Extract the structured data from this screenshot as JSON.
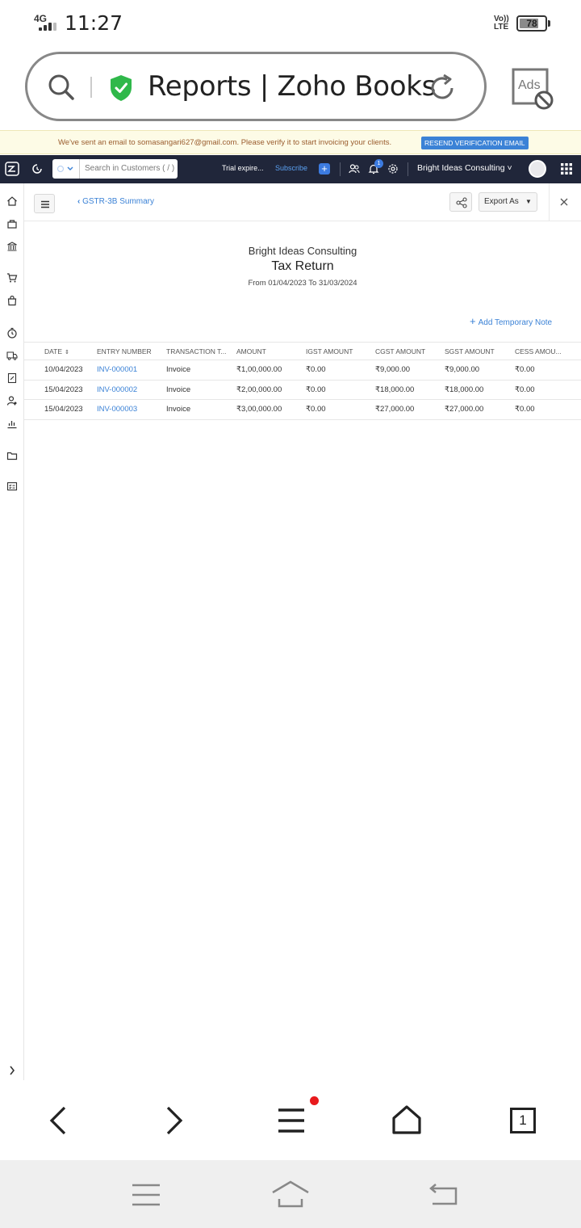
{
  "status_bar": {
    "network": "4G",
    "time": "11:27",
    "volte": "Vo)) LTE",
    "battery_percent": 78,
    "battery_label": "78"
  },
  "browser": {
    "page_title": "Reports | Zoho Books",
    "ads_label": "Ads",
    "tab_count": "1",
    "menu_has_notification": true
  },
  "banner": {
    "message": "We've sent an email to somasangari627@gmail.com. Please verify it to start invoicing your clients.",
    "resend_label": "RESEND VERIFICATION EMAIL"
  },
  "app_header": {
    "search_placeholder": "Search in Customers ( / )",
    "trial_text": "Trial expire...",
    "subscribe_label": "Subscribe",
    "notification_count": "1",
    "org_name": "Bright Ideas Consulting"
  },
  "subheader": {
    "back_label": "GSTR-3B Summary",
    "export_label": "Export As"
  },
  "report": {
    "org": "Bright Ideas Consulting",
    "title": "Tax Return",
    "period": "From 01/04/2023 To 31/03/2024",
    "add_note_label": "Add Temporary Note"
  },
  "table": {
    "columns": [
      "DATE",
      "ENTRY NUMBER",
      "TRANSACTION T...",
      "AMOUNT",
      "IGST AMOUNT",
      "CGST AMOUNT",
      "SGST AMOUNT",
      "CESS AMOU..."
    ],
    "rows": [
      {
        "date": "10/04/2023",
        "entry": "INV-000001",
        "type": "Invoice",
        "amount": "₹1,00,000.00",
        "igst": "₹0.00",
        "cgst": "₹9,000.00",
        "sgst": "₹9,000.00",
        "cess": "₹0.00"
      },
      {
        "date": "15/04/2023",
        "entry": "INV-000002",
        "type": "Invoice",
        "amount": "₹2,00,000.00",
        "igst": "₹0.00",
        "cgst": "₹18,000.00",
        "sgst": "₹18,000.00",
        "cess": "₹0.00"
      },
      {
        "date": "15/04/2023",
        "entry": "INV-000003",
        "type": "Invoice",
        "amount": "₹3,00,000.00",
        "igst": "₹0.00",
        "cgst": "₹27,000.00",
        "sgst": "₹27,000.00",
        "cess": "₹0.00"
      }
    ]
  },
  "colors": {
    "header_bg": "#20263a",
    "accent": "#3b82d6",
    "banner_bg": "#fdfbe6",
    "shield": "#2fb84a",
    "notification_dot": "#e8191c"
  }
}
